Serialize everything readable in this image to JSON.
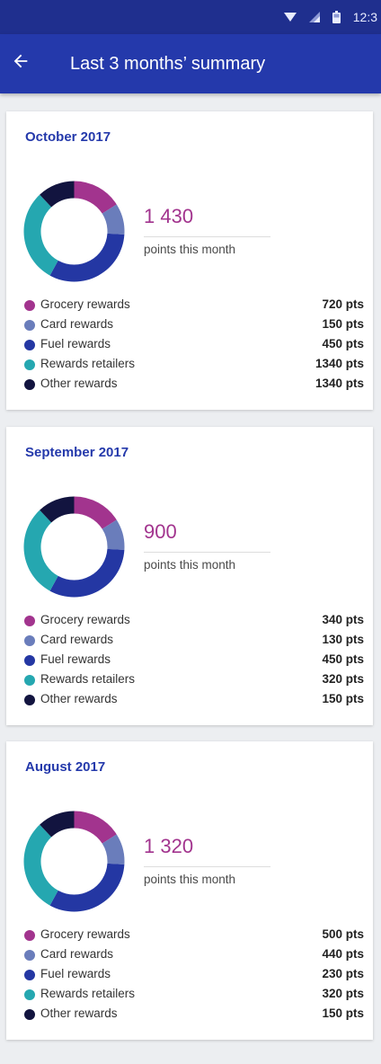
{
  "status_bar": {
    "time": "12:3",
    "icons": [
      "wifi-icon",
      "signal-icon",
      "battery-icon"
    ]
  },
  "app_bar": {
    "back_icon": "arrow-back-icon",
    "title": "Last 3 months’ summary"
  },
  "colors": {
    "app_bar": "#2439ab",
    "status_bar": "#1f2f8e",
    "grocery": "#a2348e",
    "card": "#6a7dbb",
    "fuel": "#2437a3",
    "retailers": "#25a7b0",
    "other": "#12143f"
  },
  "months": [
    {
      "title": "October 2017",
      "total": "1 430",
      "caption": "points this month",
      "rewards": [
        {
          "label": "Grocery rewards",
          "value": "720 pts",
          "color": "#a2348e"
        },
        {
          "label": "Card rewards",
          "value": "150 pts",
          "color": "#6a7dbb"
        },
        {
          "label": "Fuel rewards",
          "value": "450 pts",
          "color": "#2437a3"
        },
        {
          "label": "Rewards retailers",
          "value": "1340 pts",
          "color": "#25a7b0"
        },
        {
          "label": "Other rewards",
          "value": "1340 pts",
          "color": "#12143f"
        }
      ]
    },
    {
      "title": "September 2017",
      "total": "900",
      "caption": "points this month",
      "rewards": [
        {
          "label": "Grocery rewards",
          "value": "340 pts",
          "color": "#a2348e"
        },
        {
          "label": "Card rewards",
          "value": "130 pts",
          "color": "#6a7dbb"
        },
        {
          "label": "Fuel rewards",
          "value": "450 pts",
          "color": "#2437a3"
        },
        {
          "label": "Rewards retailers",
          "value": "320 pts",
          "color": "#25a7b0"
        },
        {
          "label": "Other rewards",
          "value": "150 pts",
          "color": "#12143f"
        }
      ]
    },
    {
      "title": "August 2017",
      "total": "1 320",
      "caption": "points this month",
      "rewards": [
        {
          "label": "Grocery rewards",
          "value": "500 pts",
          "color": "#a2348e"
        },
        {
          "label": "Card rewards",
          "value": "440 pts",
          "color": "#6a7dbb"
        },
        {
          "label": "Fuel rewards",
          "value": "230 pts",
          "color": "#2437a3"
        },
        {
          "label": "Rewards retailers",
          "value": "320 pts",
          "color": "#25a7b0"
        },
        {
          "label": "Other rewards",
          "value": "150 pts",
          "color": "#12143f"
        }
      ]
    }
  ],
  "chart_data": [
    {
      "type": "pie",
      "categories": [
        "Grocery rewards",
        "Card rewards",
        "Fuel rewards",
        "Rewards retailers",
        "Other rewards"
      ],
      "values": [
        0.16,
        0.1,
        0.32,
        0.3,
        0.12
      ],
      "colors": [
        "#a2348e",
        "#6a7dbb",
        "#2437a3",
        "#25a7b0",
        "#12143f"
      ],
      "title": "October 2017"
    },
    {
      "type": "pie",
      "categories": [
        "Grocery rewards",
        "Card rewards",
        "Fuel rewards",
        "Rewards retailers",
        "Other rewards"
      ],
      "values": [
        0.16,
        0.1,
        0.32,
        0.3,
        0.12
      ],
      "colors": [
        "#a2348e",
        "#6a7dbb",
        "#2437a3",
        "#25a7b0",
        "#12143f"
      ],
      "title": "September 2017"
    },
    {
      "type": "pie",
      "categories": [
        "Grocery rewards",
        "Card rewards",
        "Fuel rewards",
        "Rewards retailers",
        "Other rewards"
      ],
      "values": [
        0.16,
        0.1,
        0.32,
        0.3,
        0.12
      ],
      "colors": [
        "#a2348e",
        "#6a7dbb",
        "#2437a3",
        "#25a7b0",
        "#12143f"
      ],
      "title": "August 2017"
    }
  ]
}
